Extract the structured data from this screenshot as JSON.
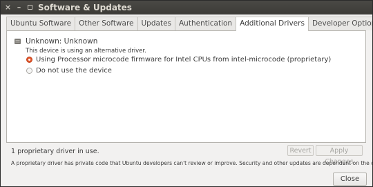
{
  "window": {
    "title": "Software & Updates"
  },
  "tabs": [
    {
      "label": "Ubuntu Software",
      "active": false
    },
    {
      "label": "Other Software",
      "active": false
    },
    {
      "label": "Updates",
      "active": false
    },
    {
      "label": "Authentication",
      "active": false
    },
    {
      "label": "Additional Drivers",
      "active": true
    },
    {
      "label": "Developer Options",
      "active": false
    }
  ],
  "device": {
    "name": "Unknown: Unknown",
    "description": "This device is using an alternative driver.",
    "icon": "chip-icon",
    "options": [
      {
        "label": "Using Processor microcode firmware for Intel CPUs from intel-microcode (proprietary)",
        "checked": true
      },
      {
        "label": "Do not use the device",
        "checked": false
      }
    ]
  },
  "status": {
    "text": "1 proprietary driver in use.",
    "revert_label": "Revert",
    "apply_label": "Apply Changes",
    "note": "A proprietary driver has private code that Ubuntu developers can't review or improve. Security and other updates are dependent on the driver vendor."
  },
  "footer": {
    "close_label": "Close"
  },
  "colors": {
    "titlebar": "#3c3b37",
    "accent_radio": "#e2562b",
    "window_bg": "#f2f1f0"
  }
}
